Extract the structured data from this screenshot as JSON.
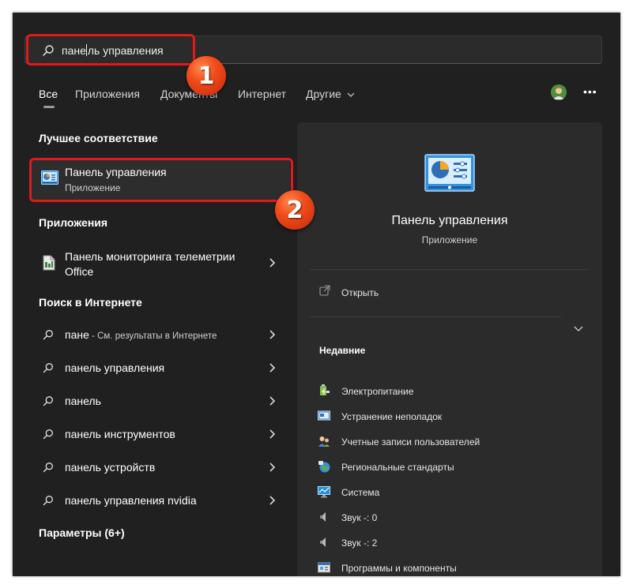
{
  "search": {
    "text_before_caret": "пане",
    "text_after_caret": "ль управления"
  },
  "tabs": [
    "Все",
    "Приложения",
    "Документы",
    "Интернет",
    "Другие"
  ],
  "avatar_icon": "user-avatar-icon",
  "more_icon": "more-horizontal-icon",
  "more_label": "•••",
  "sections": {
    "best_match": "Лучшее соответствие",
    "apps": "Приложения",
    "web": "Поиск в Интернете",
    "settings": "Параметры (6+)"
  },
  "best_match": {
    "title": "Панель управления",
    "subtitle": "Приложение",
    "icon": "control-panel-icon"
  },
  "apps": [
    {
      "line1": "Панель мониторинга телеметрии",
      "line2": "Office",
      "icon": "document-icon"
    }
  ],
  "web_results": [
    {
      "text": "пане",
      "sub": " - См. результаты в Интернете"
    },
    {
      "text": "панель управления",
      "sub": ""
    },
    {
      "text": "панель",
      "sub": ""
    },
    {
      "text": "панель инструментов",
      "sub": ""
    },
    {
      "text": "панель устройств",
      "sub": ""
    },
    {
      "text": "панель управления nvidia",
      "sub": ""
    }
  ],
  "preview": {
    "title": "Панель управления",
    "subtitle": "Приложение",
    "open_label": "Открыть",
    "recent_header": "Недавние",
    "recent": [
      {
        "label": "Электропитание",
        "icon": "power-options-icon"
      },
      {
        "label": "Устранение неполадок",
        "icon": "troubleshoot-icon"
      },
      {
        "label": "Учетные записи пользователей",
        "icon": "user-accounts-icon"
      },
      {
        "label": "Региональные стандарты",
        "icon": "region-globe-icon"
      },
      {
        "label": "Система",
        "icon": "system-monitor-icon"
      },
      {
        "label": "Звук -: 0",
        "icon": "speaker-icon"
      },
      {
        "label": "Звук -: 2",
        "icon": "speaker-icon"
      },
      {
        "label": "Программы и компоненты",
        "icon": "programs-icon"
      }
    ]
  },
  "annotations": {
    "badge_1": "1",
    "badge_2": "2",
    "highlight_color": "#e0191c",
    "badge_color": "#f24d1a"
  },
  "colors": {
    "background": "#202020",
    "panel": "#2b2b2b",
    "selected_row": "#2d2d2d",
    "text": "#ffffff"
  }
}
